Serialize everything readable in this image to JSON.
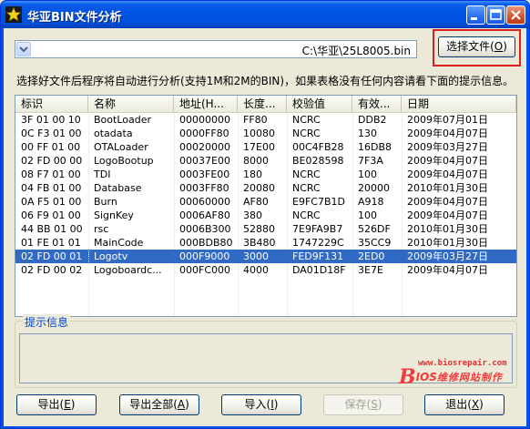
{
  "window": {
    "title": "华亚BIN文件分析"
  },
  "path": {
    "value": "C:\\华亚\\25L8005.bin"
  },
  "choose_button": {
    "label_pre": "选择文件(",
    "accel": "O",
    "label_post": ")"
  },
  "hint_text": "选择好文件后程序将自动进行分析(支持1M和2M的BIN)，如果表格没有任何内容请看下面的提示信息。",
  "table": {
    "columns": [
      "标识",
      "名称",
      "地址(H...",
      "长度...",
      "校验值",
      "有效...",
      "日期"
    ],
    "selected_index": 10,
    "rows": [
      [
        "3F 01 00 10",
        "BootLoader",
        "00000000",
        "FF80",
        "NCRC",
        "DDB2",
        "2009年07月01日"
      ],
      [
        "0C F3 01 00",
        "otadata",
        "0000FF80",
        "10080",
        "NCRC",
        "130",
        "2009年04月07日"
      ],
      [
        "00 FF 01 00",
        "OTALoader",
        "00020000",
        "17E00",
        "00C4FB28",
        "16DB8",
        "2009年03月27日"
      ],
      [
        "02 FD 00 00",
        "LogoBootup",
        "00037E00",
        "8000",
        "BE028598",
        "7F3A",
        "2009年04月07日"
      ],
      [
        "08 F7 01 00",
        "TDI",
        "0003FE00",
        "180",
        "NCRC",
        "100",
        "2009年04月07日"
      ],
      [
        "04 FB 01 00",
        "Database",
        "0003FF80",
        "20080",
        "NCRC",
        "20000",
        "2010年01月30日"
      ],
      [
        "0A F5 01 00",
        "Burn",
        "00060000",
        "AF80",
        "E9FC7B1D",
        "A918",
        "2009年04月07日"
      ],
      [
        "06 F9 01 00",
        "SignKey",
        "0006AF80",
        "380",
        "NCRC",
        "100",
        "2009年04月07日"
      ],
      [
        "44 BB 01 00",
        "rsc",
        "0006B300",
        "52880",
        "7E9FA9B7",
        "526DF",
        "2010年01月30日"
      ],
      [
        "01 FE 01 01",
        "MainCode",
        "000BDB80",
        "3B480",
        "1747229C",
        "35CC9",
        "2010年01月30日"
      ],
      [
        "02 FD 00 01",
        "Logotv",
        "000F9000",
        "3000",
        "FED9F131",
        "2ED0",
        "2009年03月27日"
      ],
      [
        "02 FD 00 02",
        "Logoboardc...",
        "000FC000",
        "4000",
        "DA01D18F",
        "3E7E",
        "2009年04月07日"
      ]
    ]
  },
  "info_group": {
    "label": "提示信息",
    "message": ""
  },
  "watermark": {
    "url": "www.biosrepair.com",
    "b": "B",
    "ios": "IOS",
    "cn": "维修网站制作"
  },
  "buttons": {
    "export": {
      "label_pre": "导出(",
      "accel": "E",
      "label_post": ")"
    },
    "export_all": {
      "label_pre": "导出全部(",
      "accel": "A",
      "label_post": ")"
    },
    "import": {
      "label_pre": "导入(",
      "accel": "I",
      "label_post": ")"
    },
    "save": {
      "label_pre": "保存(",
      "accel": "S",
      "label_post": ")"
    },
    "exit": {
      "label_pre": "退出(",
      "accel": "X",
      "label_post": ")"
    }
  },
  "colors": {
    "selection": "#316ac5",
    "titlebar": "#0054e3",
    "highlight_box": "#e02020"
  },
  "icons": {
    "app": "star-icon",
    "combo": "chevron-down-icon"
  }
}
